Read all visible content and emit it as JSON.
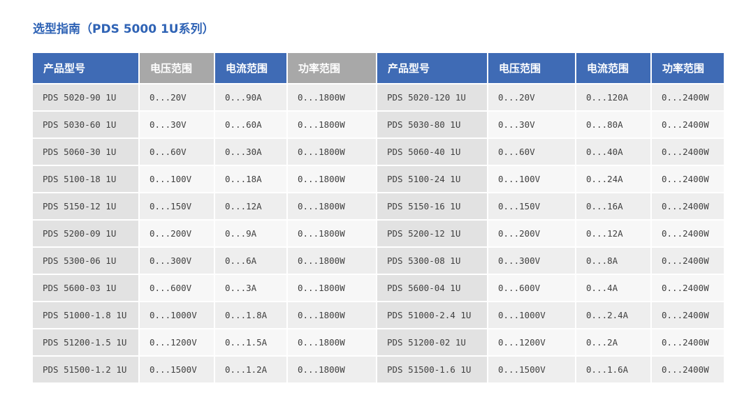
{
  "page": {
    "title": "选型指南（PDS 5000 1U系列）"
  },
  "table": {
    "headers": [
      "产品型号",
      "电压范围",
      "电流范围",
      "功率范围",
      "产品型号",
      "电压范围",
      "电流范围",
      "功率范围"
    ],
    "rows": [
      [
        "PDS 5020-90 1U",
        "0...20V",
        "0...90A",
        "0...1800W",
        "PDS 5020-120 1U",
        "0...20V",
        "0...120A",
        "0...2400W"
      ],
      [
        "PDS 5030-60 1U",
        "0...30V",
        "0...60A",
        "0...1800W",
        "PDS 5030-80 1U",
        "0...30V",
        "0...80A",
        "0...2400W"
      ],
      [
        "PDS 5060-30 1U",
        "0...60V",
        "0...30A",
        "0...1800W",
        "PDS 5060-40 1U",
        "0...60V",
        "0...40A",
        "0...2400W"
      ],
      [
        "PDS 5100-18 1U",
        "0...100V",
        "0...18A",
        "0...1800W",
        "PDS 5100-24 1U",
        "0...100V",
        "0...24A",
        "0...2400W"
      ],
      [
        "PDS 5150-12 1U",
        "0...150V",
        "0...12A",
        "0...1800W",
        "PDS 5150-16 1U",
        "0...150V",
        "0...16A",
        "0...2400W"
      ],
      [
        "PDS 5200-09 1U",
        "0...200V",
        "0...9A",
        "0...1800W",
        "PDS 5200-12 1U",
        "0...200V",
        "0...12A",
        "0...2400W"
      ],
      [
        "PDS 5300-06 1U",
        "0...300V",
        "0...6A",
        "0...1800W",
        "PDS 5300-08 1U",
        "0...300V",
        "0...8A",
        "0...2400W"
      ],
      [
        "PDS 5600-03 1U",
        "0...600V",
        "0...3A",
        "0...1800W",
        "PDS 5600-04 1U",
        "0...600V",
        "0...4A",
        "0...2400W"
      ],
      [
        "PDS 51000-1.8 1U",
        "0...1000V",
        "0...1.8A",
        "0...1800W",
        "PDS 51000-2.4 1U",
        "0...1000V",
        "0...2.4A",
        "0...2400W"
      ],
      [
        "PDS 51200-1.5 1U",
        "0...1200V",
        "0...1.5A",
        "0...1800W",
        "PDS 51200-02 1U",
        "0...1200V",
        "0...2A",
        "0...2400W"
      ],
      [
        "PDS 51500-1.2 1U",
        "0...1500V",
        "0...1.2A",
        "0...1800W",
        "PDS 51500-1.6 1U",
        "0...1500V",
        "0...1.6A",
        "0...2400W"
      ]
    ]
  },
  "colors": {
    "title": "#2f63b5",
    "header_blue": "#3f6bb5",
    "header_gray": "#a8a8a8"
  }
}
